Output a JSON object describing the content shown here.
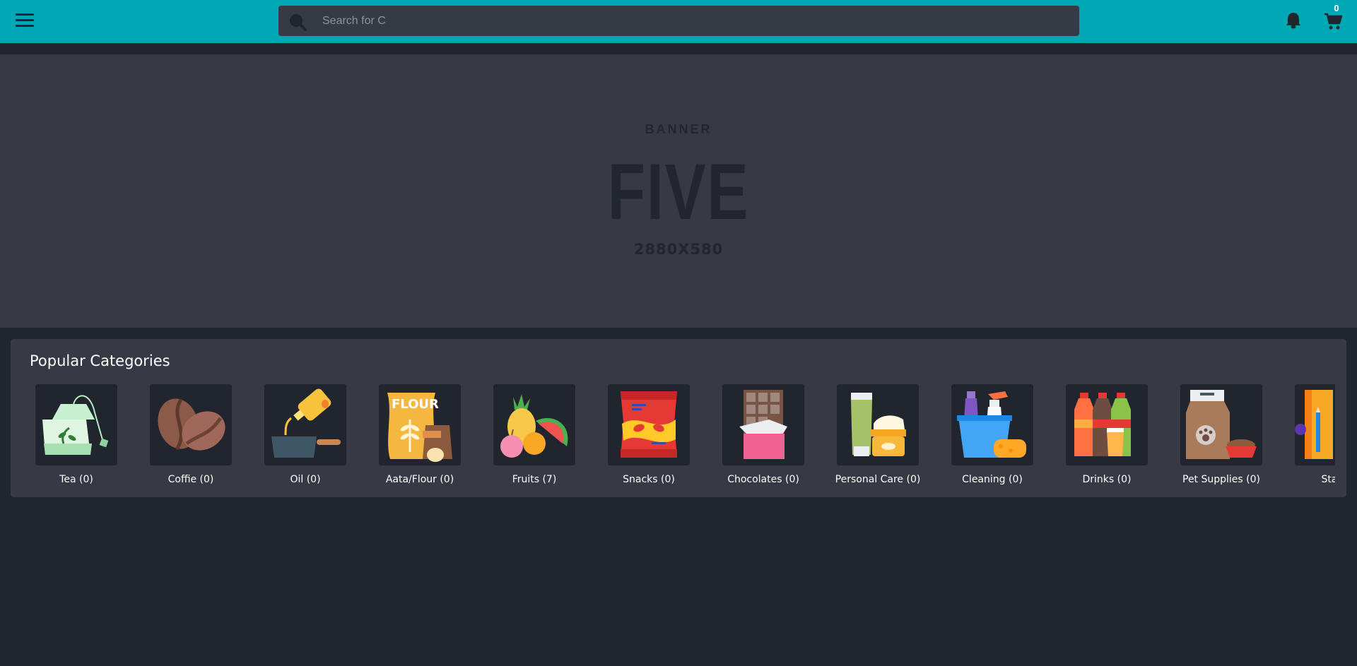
{
  "header": {
    "menu_icon": "hamburger-menu-icon",
    "search": {
      "placeholder": "Search for C",
      "value": "",
      "icon": "search-icon"
    },
    "notification_icon": "bell-icon",
    "cart_icon": "shopping-cart-icon",
    "cart_count": "0",
    "accent_color": "#00a8b5"
  },
  "banner": {
    "kicker": "BANNER",
    "title": "FIVE",
    "size": "2880X580"
  },
  "categories": {
    "title": "Popular Categories",
    "items": [
      {
        "label": "Tea (0)",
        "icon": "tea-bag-icon"
      },
      {
        "label": "Coffie (0)",
        "icon": "coffee-beans-icon"
      },
      {
        "label": "Oil (0)",
        "icon": "oil-bottle-icon"
      },
      {
        "label": "Aata/Flour (0)",
        "icon": "flour-sack-icon"
      },
      {
        "label": "Fruits (7)",
        "icon": "fruits-icon"
      },
      {
        "label": "Snacks (0)",
        "icon": "chips-bag-icon"
      },
      {
        "label": "Chocolates (0)",
        "icon": "chocolate-bar-icon"
      },
      {
        "label": "Personal Care (0)",
        "icon": "personal-care-icon"
      },
      {
        "label": "Cleaning (0)",
        "icon": "cleaning-supplies-icon"
      },
      {
        "label": "Drinks (0)",
        "icon": "soda-bottles-icon"
      },
      {
        "label": "Pet Supplies (0)",
        "icon": "pet-food-icon"
      },
      {
        "label": "Statio",
        "icon": "stationery-icon"
      }
    ]
  }
}
